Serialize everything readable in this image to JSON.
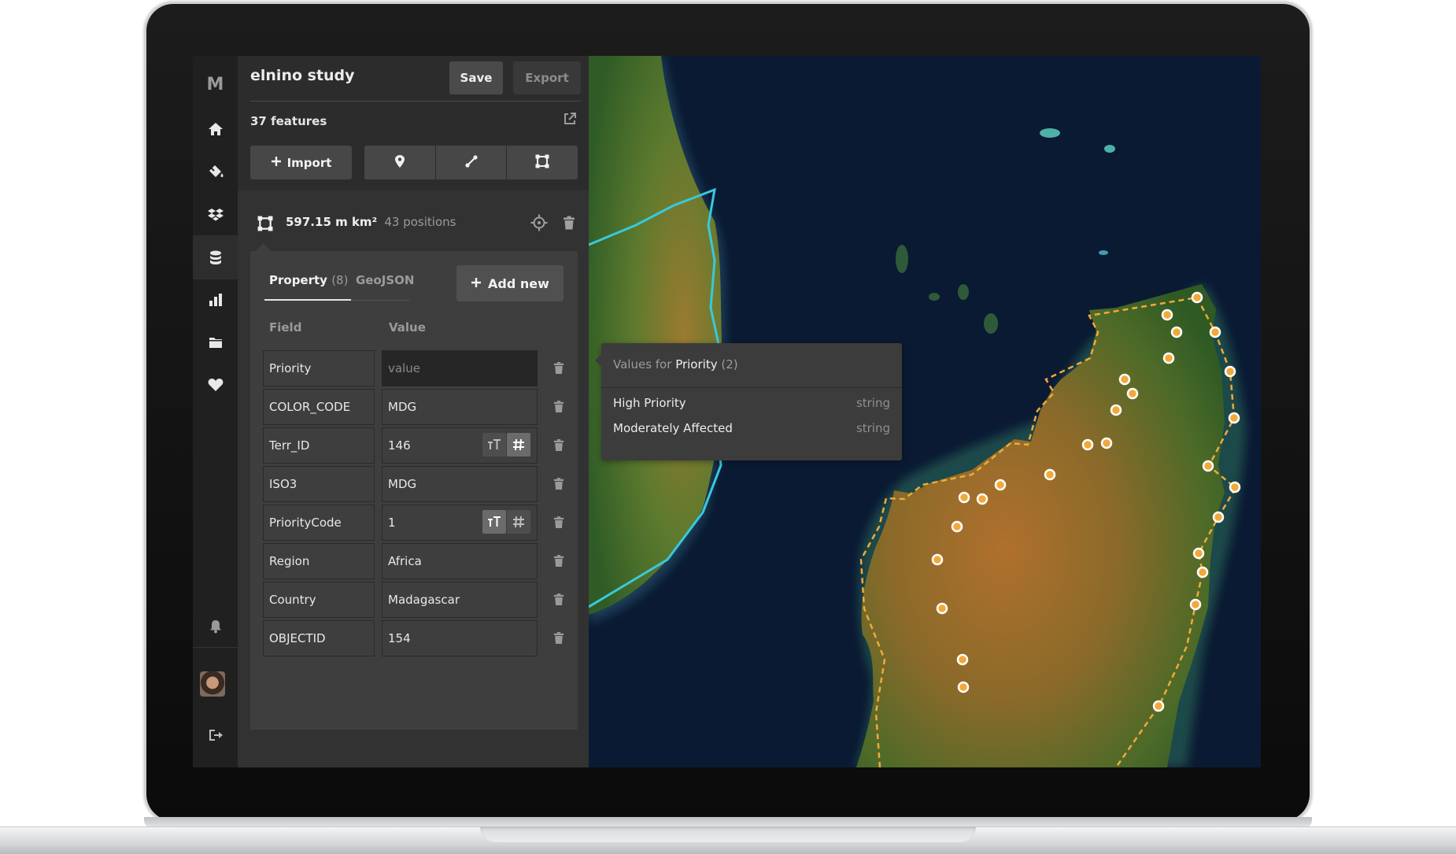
{
  "app": {
    "logo": "M",
    "document_title": "elnino study",
    "save_label": "Save",
    "export_label": "Export"
  },
  "features": {
    "count_label": "37 features",
    "import_label": "Import"
  },
  "selected_feature": {
    "area": "597.15 m km²",
    "positions": "43 positions"
  },
  "properties": {
    "tab_property": "Property",
    "tab_property_count": "(8)",
    "tab_geojson": "GeoJSON",
    "add_new_label": "Add new",
    "col_field": "Field",
    "col_value": "Value",
    "rows": [
      {
        "field": "Priority",
        "value": "value",
        "editing": true
      },
      {
        "field": "COLOR_CODE",
        "value": "MDG"
      },
      {
        "field": "Terr_ID",
        "value": "146",
        "type": "number"
      },
      {
        "field": "ISO3",
        "value": "MDG"
      },
      {
        "field": "PriorityCode",
        "value": "1",
        "type": "text"
      },
      {
        "field": "Region",
        "value": "Africa"
      },
      {
        "field": "Country",
        "value": "Madagascar"
      },
      {
        "field": "OBJECTID",
        "value": "154"
      }
    ]
  },
  "popover": {
    "prefix": "Values for",
    "key": "Priority",
    "count": "(2)",
    "items": [
      {
        "label": "High Priority",
        "type": "string"
      },
      {
        "label": "Moderately Affected",
        "type": "string"
      }
    ]
  },
  "colors": {
    "panel": "#323232",
    "rail": "#202020",
    "ocean": "#0a1428",
    "polygon_outline": "#38c9dc",
    "vertex": "#f0a93a"
  }
}
